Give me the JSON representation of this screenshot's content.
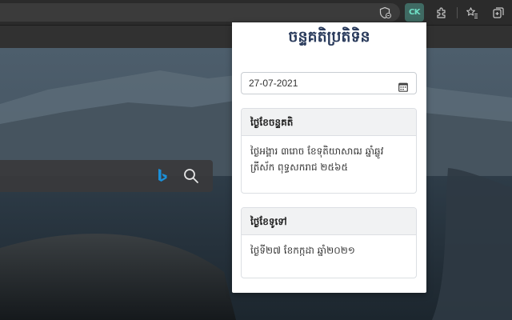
{
  "browser": {
    "extension_badge": "CK",
    "icons": [
      "tracking-prevention-icon",
      "extension-ck-icon",
      "extensions-icon",
      "favorites-icon",
      "collections-icon"
    ]
  },
  "popup": {
    "title": "ចន្ទគតិប្រតិទិន",
    "date_value": "27-07-2021",
    "lunar_card": {
      "header": "ថ្ងៃខែចន្ទគតិ",
      "body": "ថ្ងៃអង្គារ ៣រោច ខែទុតិយាសាឍ ឆ្នាំឆ្លូវ ត្រីស័ក ពុទ្ធសករាជ ២៥៦៥"
    },
    "solar_card": {
      "header": "ថ្ងៃខែទូទៅ",
      "body": "ថ្ងៃទី២៧ ខែកក្កដា ឆ្នាំ២០២១"
    }
  },
  "colors": {
    "popup_title": "#2a3b5c",
    "extension_accent": "#6fe0c6",
    "bing_blue": "#1b8fd8"
  }
}
